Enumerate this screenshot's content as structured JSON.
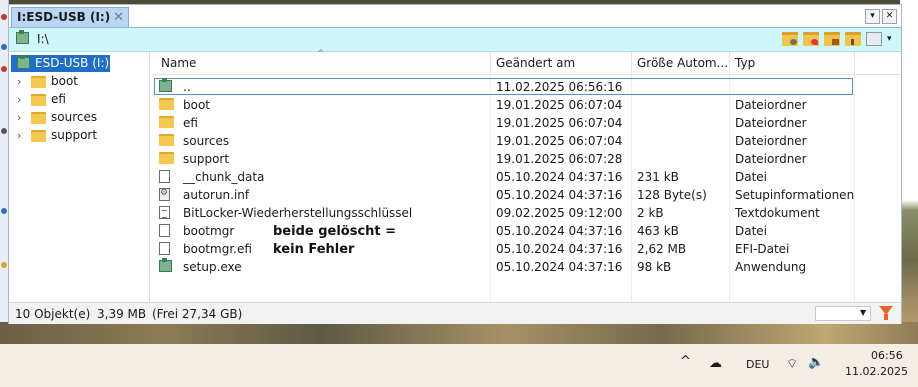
{
  "tab": {
    "title": "I:ESD-USB (I:)",
    "close": "✕"
  },
  "window_buttons": {
    "dropdown": "▾",
    "close": "✕"
  },
  "address": {
    "path": "I:\\"
  },
  "tree": {
    "root": "ESD-USB (I:)",
    "items": [
      {
        "label": "boot"
      },
      {
        "label": "efi"
      },
      {
        "label": "sources"
      },
      {
        "label": "support"
      }
    ]
  },
  "columns": {
    "name": "Name",
    "modified": "Geändert am",
    "size": "Größe Autom...",
    "type": "Typ"
  },
  "files": [
    {
      "icon": "usb-drive-icon",
      "name": "..",
      "modified": "11.02.2025 06:56:16",
      "size": "",
      "type": ""
    },
    {
      "icon": "folder-icon",
      "name": "boot",
      "modified": "19.01.2025 06:07:04",
      "size": "",
      "type": "Dateiordner"
    },
    {
      "icon": "folder-icon",
      "name": "efi",
      "modified": "19.01.2025 06:07:04",
      "size": "",
      "type": "Dateiordner"
    },
    {
      "icon": "folder-icon",
      "name": "sources",
      "modified": "19.01.2025 06:07:04",
      "size": "",
      "type": "Dateiordner"
    },
    {
      "icon": "folder-icon",
      "name": "support",
      "modified": "19.01.2025 06:07:28",
      "size": "",
      "type": "Dateiordner"
    },
    {
      "icon": "file-icon",
      "name": "__chunk_data",
      "modified": "05.10.2024 04:37:16",
      "size": "231 kB",
      "type": "Datei"
    },
    {
      "icon": "settings-file-icon",
      "name": "autorun.inf",
      "modified": "05.10.2024 04:37:16",
      "size": "128 Byte(s)",
      "type": "Setupinformationen"
    },
    {
      "icon": "text-file-icon",
      "name": "BitLocker-Wiederherstellungsschlüssel",
      "modified": "09.02.2025 09:12:00",
      "size": "2 kB",
      "type": "Textdokument"
    },
    {
      "icon": "file-icon",
      "name": "bootmgr",
      "modified": "05.10.2024 04:37:16",
      "size": "463 kB",
      "type": "Datei"
    },
    {
      "icon": "file-icon",
      "name": "bootmgr.efi",
      "modified": "05.10.2024 04:37:16",
      "size": "2,62 MB",
      "type": "EFI-Datei"
    },
    {
      "icon": "app-icon",
      "name": "setup.exe",
      "modified": "05.10.2024 04:37:16",
      "size": "98 kB",
      "type": "Anwendung"
    }
  ],
  "annotation": {
    "line1": "beide gelöscht =",
    "line2": "kein Fehler"
  },
  "status": {
    "count": "10 Objekt(e)",
    "total": "3,39 MB",
    "free": "(Frei 27,34 GB)"
  },
  "taskbar": {
    "language": "DEU",
    "time": "06:56",
    "date": "11.02.2025"
  },
  "colors": {
    "address_bar": "#cdf7fb",
    "tab": "#b9d7f4",
    "selection": "#1f6fc5",
    "filter": "#e8642a"
  }
}
